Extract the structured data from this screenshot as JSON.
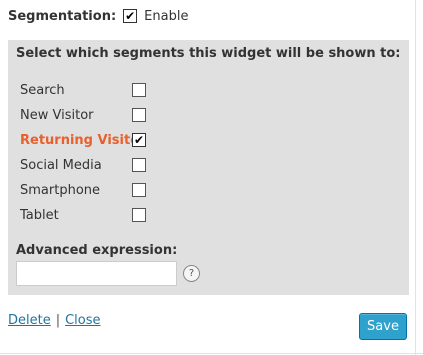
{
  "segmentation": {
    "label": "Segmentation:",
    "enabled": true,
    "enable_label": "Enable",
    "check_glyph": "✔"
  },
  "panel": {
    "title": "Select which segments this widget will be shown to:",
    "segments": [
      {
        "label": "Search",
        "checked": false
      },
      {
        "label": "New Visitor",
        "checked": false
      },
      {
        "label": "Returning Visitor",
        "checked": true
      },
      {
        "label": "Social Media",
        "checked": false
      },
      {
        "label": "Smartphone",
        "checked": false
      },
      {
        "label": "Tablet",
        "checked": false
      }
    ],
    "advanced_label": "Advanced expression:",
    "advanced_value": "",
    "help_glyph": "?"
  },
  "footer": {
    "delete_label": "Delete",
    "separator": "|",
    "close_label": "Close",
    "save_label": "Save"
  },
  "colors": {
    "panel_bg": "#e0e0e0",
    "highlight": "#e8602c",
    "link": "#21759b",
    "button": "#2ea2cc"
  }
}
